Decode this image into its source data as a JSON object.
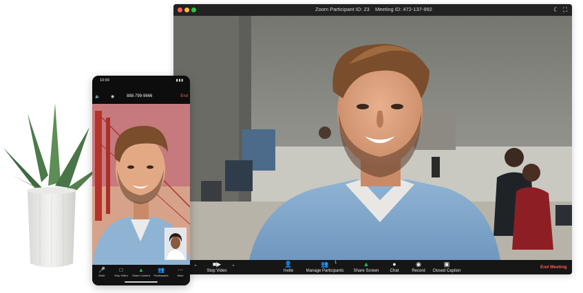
{
  "desktop": {
    "title_participant": "Zoom Participant ID: 23",
    "title_meeting": "Meeting ID: 472-137-992",
    "toolbar": {
      "stop_video": "Stop Video",
      "invite": "Invite",
      "manage_participants": "Manage Participants",
      "participant_count": "1",
      "share_screen": "Share Screen",
      "chat": "Chat",
      "record": "Record",
      "closed_caption": "Closed Caption",
      "end_meeting": "End Meeting"
    }
  },
  "phone": {
    "time": "10:09",
    "phone_number": "888-799-9666",
    "end_label": "End",
    "toolbar": {
      "mute": "Mute",
      "stop_video": "Stop Video",
      "share_content": "Share Content",
      "participants": "Participants",
      "more": "More"
    }
  },
  "icons": {
    "window_controls": [
      "close-icon",
      "minimize-icon",
      "maximize-icon"
    ],
    "moon": "moon-icon",
    "fullscreen": "fullscreen-icon",
    "camera": "video-camera-icon",
    "invite": "invite-user-icon",
    "participants": "participants-icon",
    "share": "share-screen-icon",
    "chat": "chat-bubble-icon",
    "record": "record-icon",
    "caption": "closed-caption-icon"
  },
  "colors": {
    "end_red": "#ff5b50",
    "share_green": "#2ec24a",
    "toolbar_bg": "#161616"
  }
}
